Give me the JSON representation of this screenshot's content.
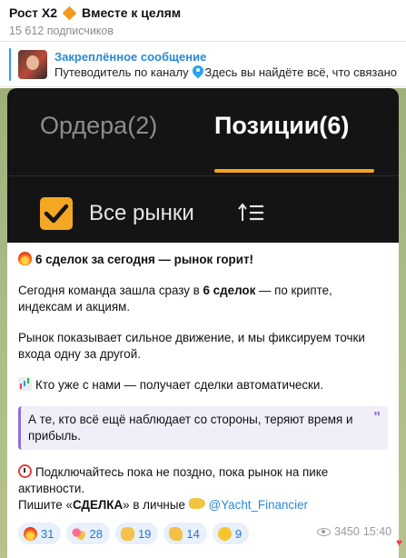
{
  "channel": {
    "title_part1": "Рост X2",
    "title_part2": "Вместе к целям",
    "subscribers": "15 612 подписчиков"
  },
  "pinned": {
    "title": "Закреплённое сообщение",
    "preview_part1": "Путеводитель по каналу",
    "preview_part2": "Здесь вы найдёте всё, что связано"
  },
  "post_image": {
    "tab_orders": "Ордера(2)",
    "tab_positions": "Позиции(6)",
    "markets_label": "Все рынки"
  },
  "post": {
    "headline": "6 сделок за сегодня — рынок горит!",
    "p2_part1": "Сегодня команда зашла сразу в ",
    "p2_bold": "6 сделок",
    "p2_part2": " — по крипте, индексам и акциям.",
    "p3": "Рынок показывает сильное движение, и мы фиксируем точки входа одну за другой.",
    "p4": "Кто уже с нами — получает сделки автоматически.",
    "quote": "А те, кто всё ещё наблюдает со стороны, теряют время и прибыль.",
    "p5_line1": "Подключайтесь пока не поздно, пока рынок на пике активности.",
    "p5_prefix": "Пишите «",
    "p5_bold": "СДЕЛКА",
    "p5_mid": "» в личные",
    "handle": "@Yacht_Financier"
  },
  "reactions": [
    {
      "icon": "fire",
      "count": "31"
    },
    {
      "icon": "hearts",
      "count": "28"
    },
    {
      "icon": "thumbs-up",
      "count": "19"
    },
    {
      "icon": "clap",
      "count": "14"
    },
    {
      "icon": "cool",
      "count": "9"
    }
  ],
  "meta": {
    "views": "3450",
    "time": "15:40"
  },
  "colors": {
    "accent": "#2a89d6",
    "tab_underline": "#f3a31e",
    "quote_border": "#8d6ddc"
  }
}
